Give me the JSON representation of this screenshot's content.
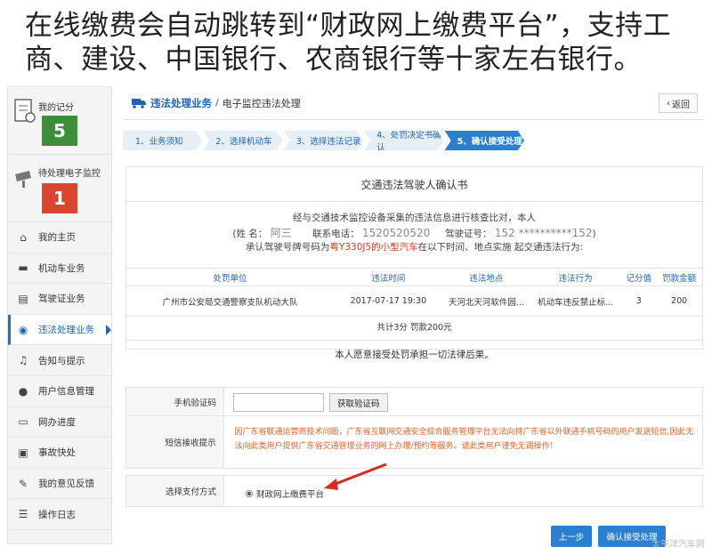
{
  "caption": {
    "line1": "在线缴费会自动跳转到“财政网上缴费平台”，支持工",
    "line2": "商、建设、中国银行、农商银行等十家左右银行。"
  },
  "sidebar": {
    "score": {
      "label": "我的记分",
      "value": "5"
    },
    "pending": {
      "label": "待处理电子监控",
      "value": "1"
    },
    "items": [
      {
        "label": "我的主页",
        "icon": "home-icon"
      },
      {
        "label": "机动车业务",
        "icon": "truck-icon"
      },
      {
        "label": "驾驶证业务",
        "icon": "id-card-icon"
      },
      {
        "label": "违法处理业务",
        "icon": "camera-icon",
        "active": true
      },
      {
        "label": "告知与提示",
        "icon": "bell-icon"
      },
      {
        "label": "用户信息管理",
        "icon": "user-icon"
      },
      {
        "label": "网办进度",
        "icon": "progress-icon"
      },
      {
        "label": "事故快处",
        "icon": "accident-icon"
      },
      {
        "label": "我的意见反馈",
        "icon": "feedback-icon"
      },
      {
        "label": "操作日志",
        "icon": "log-icon"
      }
    ]
  },
  "breadcrumb": {
    "main": "违法处理业务",
    "sep": "/",
    "sub": "电子监控违法处理"
  },
  "back_label": "返回",
  "steps": [
    "1、业务须知",
    "2、选择机动车",
    "3、选择违法记录",
    "4、处罚决定书确认",
    "5、确认接受处理"
  ],
  "confirm_title": "交通违法驾驶人确认书",
  "statement": {
    "line1": "经与交通技术监控设备采集的违法信息进行核查比对，本人",
    "name_label": "(姓 名：",
    "name_value": "阿三",
    "phone_label": "联系电话：",
    "phone_value": "1520520520",
    "license_label": "驾驶证号：",
    "license_value": "152 **********152",
    "license_end": ")",
    "plate_prefix": "承认驾驶号牌号码为",
    "plate_value": "粤Y330J5的小型汽车",
    "plate_suffix": "在以下时间、地点实施 起交通违法行为:"
  },
  "table": {
    "headers": [
      "处罚单位",
      "违法时间",
      "违法地点",
      "违法行为",
      "记分值",
      "罚款金额"
    ],
    "row": [
      "广州市公安局交通警察支队机动大队",
      "2017-07-17 19:30",
      "天河北天河软件园...",
      "机动车违反禁止标...",
      "3",
      "200"
    ]
  },
  "total_text": "共计3分 罚款200元",
  "accept_text": "本人愿意接受处罚承担一切法律后果。",
  "form": {
    "phone_code_label": "手机验证码",
    "get_code_label": "获取验证码",
    "sms_label": "短信接收提示",
    "sms_notice": "因广东省联通运营商技术问题，广东省互联网交通安全综合服务管理平台无法向持广东省以外联通手机号码的用户发送短信,因此无法向此类用户提供广东省交通管理业务的网上办理/预约等服务。请此类用户谨免无调操作！"
  },
  "payment": {
    "label": "选择支付方式",
    "option": "财政网上缴费平台"
  },
  "buttons": {
    "prev": "上一步",
    "confirm": "确认接受处理"
  },
  "watermark": "太平洋汽车网"
}
